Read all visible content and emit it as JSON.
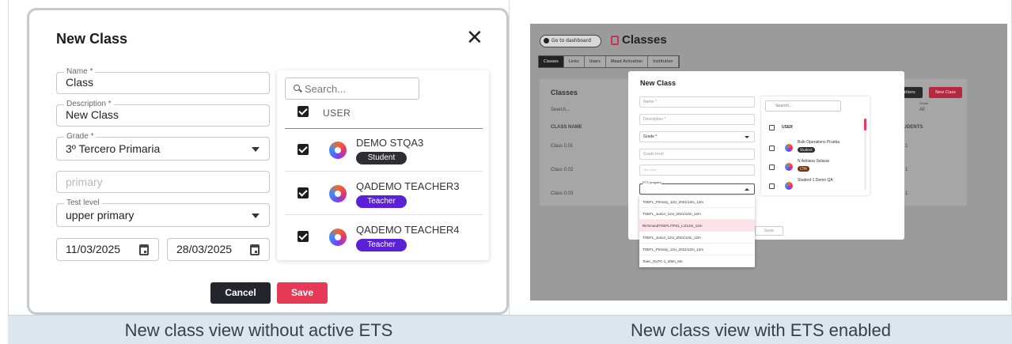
{
  "captions": {
    "left": "New class view without active ETS",
    "right": "New class view with ETS enabled"
  },
  "modal": {
    "title": "New Class",
    "close_symbol": "✕",
    "fields": {
      "name": {
        "label": "Name *",
        "value": "Class"
      },
      "description": {
        "label": "Description *",
        "value": "New Class"
      },
      "grade": {
        "label": "Grade *",
        "value": "3º Tercero Primaria"
      },
      "grade_level": {
        "placeholder": "primary"
      },
      "test_level": {
        "label": "Test level",
        "value": "upper primary"
      },
      "start_date": "11/03/2025",
      "end_date": "28/03/2025"
    },
    "users": {
      "search_placeholder": "Search...",
      "column_header": "USER",
      "rows": [
        {
          "name": "DEMO STQA3",
          "role": "Student"
        },
        {
          "name": "QADEMO TEACHER3",
          "role": "Teacher"
        },
        {
          "name": "QADEMO TEACHER4",
          "role": "Teacher"
        }
      ]
    },
    "buttons": {
      "cancel": "Cancel",
      "save": "Save"
    }
  },
  "ets_screenshot": {
    "dashboard_button": "Go to dashboard",
    "page_title": "Classes",
    "tabs": [
      "Classes",
      "Links",
      "Users",
      "iRead Activation",
      "Institution"
    ],
    "card_title": "Classes",
    "card_search": "Search...",
    "table_header_name": "CLASS NAME",
    "table_header_students": "STUDENTS",
    "class_rows": [
      "Class 0.01",
      "Class 0.02",
      "Class 0.03"
    ],
    "student_counts": [
      "1",
      "1",
      "1"
    ],
    "grade_label": "Grade",
    "grade_value": "All",
    "operations_button": "Operations",
    "new_class_button": "New Class",
    "modal_title": "New Class",
    "fields": {
      "name": "Name *",
      "description": "Description *",
      "grade": "Grade *",
      "grade_level": "Grade level",
      "test_level": "Test level",
      "ets_program": "ETS program"
    },
    "ets_options": [
      "TOEFL_Primary_12U_2021/12m_12m",
      "TOEFL_Junior_12U_2021/12m_12m",
      "RichmondTOEFLITP21_L1/12m_12m",
      "TOEFL_Junior_12U_2021/12m_12m",
      "TOEFL_Primary_12U_2021/12m_12m",
      "Toiec_OLPC-1_3/6m_6m"
    ],
    "user_search": "Search...",
    "user_header": "USER",
    "users": [
      {
        "name": "Bulk Operations Prueba",
        "badge": "Student"
      },
      {
        "name": "N Adriana Solazar",
        "badge": "CTM"
      },
      {
        "name": "Student 1 Demo QA",
        "badge": ""
      }
    ],
    "save_button": "Save"
  },
  "colors": {
    "accent": "#e73a56",
    "dark_button": "#25262d",
    "teacher_badge": "#5b21d6",
    "student_badge": "#2e2e33",
    "caption_bg": "#dce6ee"
  }
}
